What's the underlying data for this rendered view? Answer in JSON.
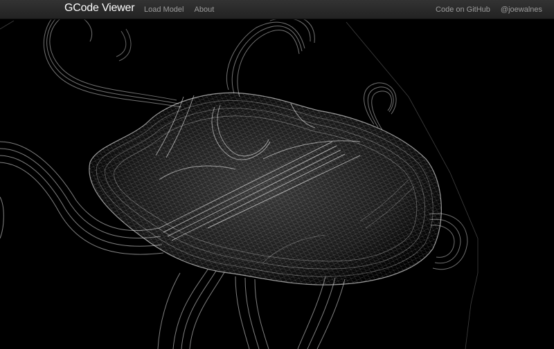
{
  "app": {
    "brand": "GCode Viewer"
  },
  "nav": {
    "left": [
      {
        "label": "Load Model"
      },
      {
        "label": "About"
      }
    ],
    "right": [
      {
        "label": "Code on GitHub"
      },
      {
        "label": "@joewalnes"
      }
    ]
  },
  "colors": {
    "navbar_top": "#333333",
    "navbar_bottom": "#222222",
    "brand_text": "#ffffff",
    "nav_text": "#9d9d9d",
    "canvas_bg": "#000000",
    "wireframe": "#ffffff"
  },
  "icons": []
}
